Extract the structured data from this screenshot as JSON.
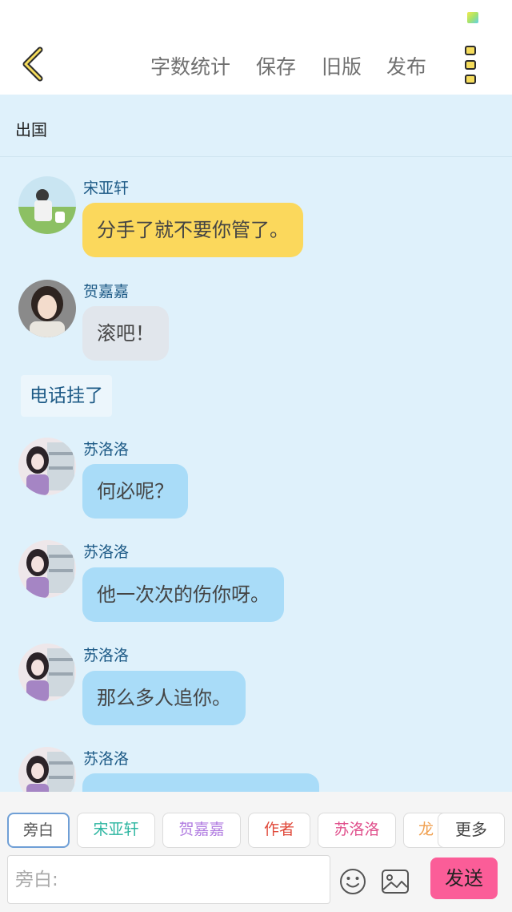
{
  "header": {
    "stats_label": "字数统计",
    "save_label": "保存",
    "old_label": "旧版",
    "publish_label": "发布"
  },
  "topic": "出国",
  "messages": [
    {
      "name": "宋亚轩",
      "text": "分手了就不要你管了。",
      "color": "#fbd85c"
    },
    {
      "name": "贺嘉嘉",
      "text": "滚吧！",
      "color": "#e1e6ec"
    },
    {
      "name": "苏洛洛",
      "text": "何必呢？",
      "color": "#a9dcf8"
    },
    {
      "name": "苏洛洛",
      "text": "他一次次的伤你呀。",
      "color": "#a9dcf8"
    },
    {
      "name": "苏洛洛",
      "text": "那么多人追你。",
      "color": "#a9dcf8"
    },
    {
      "name": "苏洛洛",
      "text": "",
      "color": "#a9dcf8"
    }
  ],
  "narration": "电话挂了",
  "roles": [
    {
      "label": "旁白",
      "color": "#555555"
    },
    {
      "label": "宋亚轩",
      "color": "#2bb5a0"
    },
    {
      "label": "贺嘉嘉",
      "color": "#b07be0"
    },
    {
      "label": "作者",
      "color": "#e0493a"
    },
    {
      "label": "苏洛洛",
      "color": "#e0508c"
    },
    {
      "label": "龙",
      "color": "#f0a050"
    }
  ],
  "more_label": "更多",
  "input": {
    "placeholder": "旁白:"
  },
  "send_label": "发送",
  "icons": [
    "back-arrow-icon",
    "more-vertical-icon",
    "emoji-icon",
    "image-icon"
  ]
}
